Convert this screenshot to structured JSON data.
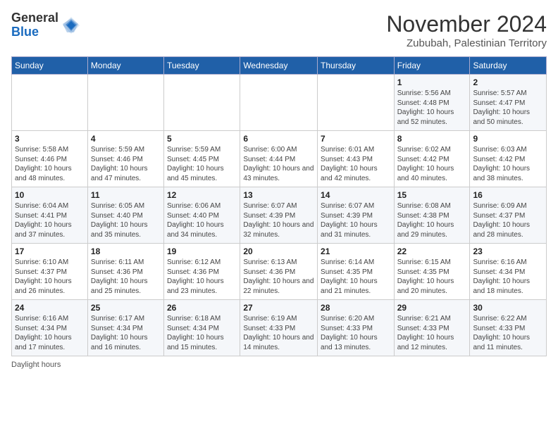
{
  "header": {
    "logo_general": "General",
    "logo_blue": "Blue",
    "month_title": "November 2024",
    "location": "Zububah, Palestinian Territory"
  },
  "columns": [
    "Sunday",
    "Monday",
    "Tuesday",
    "Wednesday",
    "Thursday",
    "Friday",
    "Saturday"
  ],
  "weeks": [
    [
      {
        "day": "",
        "info": ""
      },
      {
        "day": "",
        "info": ""
      },
      {
        "day": "",
        "info": ""
      },
      {
        "day": "",
        "info": ""
      },
      {
        "day": "",
        "info": ""
      },
      {
        "day": "1",
        "info": "Sunrise: 5:56 AM\nSunset: 4:48 PM\nDaylight: 10 hours and 52 minutes."
      },
      {
        "day": "2",
        "info": "Sunrise: 5:57 AM\nSunset: 4:47 PM\nDaylight: 10 hours and 50 minutes."
      }
    ],
    [
      {
        "day": "3",
        "info": "Sunrise: 5:58 AM\nSunset: 4:46 PM\nDaylight: 10 hours and 48 minutes."
      },
      {
        "day": "4",
        "info": "Sunrise: 5:59 AM\nSunset: 4:46 PM\nDaylight: 10 hours and 47 minutes."
      },
      {
        "day": "5",
        "info": "Sunrise: 5:59 AM\nSunset: 4:45 PM\nDaylight: 10 hours and 45 minutes."
      },
      {
        "day": "6",
        "info": "Sunrise: 6:00 AM\nSunset: 4:44 PM\nDaylight: 10 hours and 43 minutes."
      },
      {
        "day": "7",
        "info": "Sunrise: 6:01 AM\nSunset: 4:43 PM\nDaylight: 10 hours and 42 minutes."
      },
      {
        "day": "8",
        "info": "Sunrise: 6:02 AM\nSunset: 4:42 PM\nDaylight: 10 hours and 40 minutes."
      },
      {
        "day": "9",
        "info": "Sunrise: 6:03 AM\nSunset: 4:42 PM\nDaylight: 10 hours and 38 minutes."
      }
    ],
    [
      {
        "day": "10",
        "info": "Sunrise: 6:04 AM\nSunset: 4:41 PM\nDaylight: 10 hours and 37 minutes."
      },
      {
        "day": "11",
        "info": "Sunrise: 6:05 AM\nSunset: 4:40 PM\nDaylight: 10 hours and 35 minutes."
      },
      {
        "day": "12",
        "info": "Sunrise: 6:06 AM\nSunset: 4:40 PM\nDaylight: 10 hours and 34 minutes."
      },
      {
        "day": "13",
        "info": "Sunrise: 6:07 AM\nSunset: 4:39 PM\nDaylight: 10 hours and 32 minutes."
      },
      {
        "day": "14",
        "info": "Sunrise: 6:07 AM\nSunset: 4:39 PM\nDaylight: 10 hours and 31 minutes."
      },
      {
        "day": "15",
        "info": "Sunrise: 6:08 AM\nSunset: 4:38 PM\nDaylight: 10 hours and 29 minutes."
      },
      {
        "day": "16",
        "info": "Sunrise: 6:09 AM\nSunset: 4:37 PM\nDaylight: 10 hours and 28 minutes."
      }
    ],
    [
      {
        "day": "17",
        "info": "Sunrise: 6:10 AM\nSunset: 4:37 PM\nDaylight: 10 hours and 26 minutes."
      },
      {
        "day": "18",
        "info": "Sunrise: 6:11 AM\nSunset: 4:36 PM\nDaylight: 10 hours and 25 minutes."
      },
      {
        "day": "19",
        "info": "Sunrise: 6:12 AM\nSunset: 4:36 PM\nDaylight: 10 hours and 23 minutes."
      },
      {
        "day": "20",
        "info": "Sunrise: 6:13 AM\nSunset: 4:36 PM\nDaylight: 10 hours and 22 minutes."
      },
      {
        "day": "21",
        "info": "Sunrise: 6:14 AM\nSunset: 4:35 PM\nDaylight: 10 hours and 21 minutes."
      },
      {
        "day": "22",
        "info": "Sunrise: 6:15 AM\nSunset: 4:35 PM\nDaylight: 10 hours and 20 minutes."
      },
      {
        "day": "23",
        "info": "Sunrise: 6:16 AM\nSunset: 4:34 PM\nDaylight: 10 hours and 18 minutes."
      }
    ],
    [
      {
        "day": "24",
        "info": "Sunrise: 6:16 AM\nSunset: 4:34 PM\nDaylight: 10 hours and 17 minutes."
      },
      {
        "day": "25",
        "info": "Sunrise: 6:17 AM\nSunset: 4:34 PM\nDaylight: 10 hours and 16 minutes."
      },
      {
        "day": "26",
        "info": "Sunrise: 6:18 AM\nSunset: 4:34 PM\nDaylight: 10 hours and 15 minutes."
      },
      {
        "day": "27",
        "info": "Sunrise: 6:19 AM\nSunset: 4:33 PM\nDaylight: 10 hours and 14 minutes."
      },
      {
        "day": "28",
        "info": "Sunrise: 6:20 AM\nSunset: 4:33 PM\nDaylight: 10 hours and 13 minutes."
      },
      {
        "day": "29",
        "info": "Sunrise: 6:21 AM\nSunset: 4:33 PM\nDaylight: 10 hours and 12 minutes."
      },
      {
        "day": "30",
        "info": "Sunrise: 6:22 AM\nSunset: 4:33 PM\nDaylight: 10 hours and 11 minutes."
      }
    ]
  ],
  "footer": {
    "note": "Daylight hours"
  }
}
